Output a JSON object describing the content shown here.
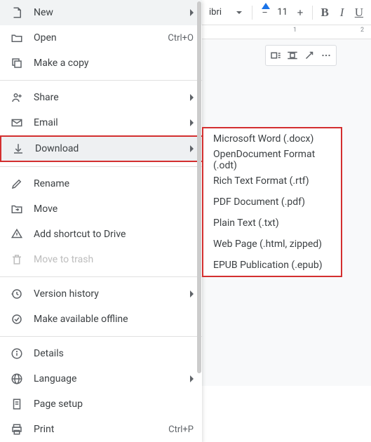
{
  "menu": {
    "items": [
      {
        "label": "New",
        "has_submenu": true
      },
      {
        "label": "Open",
        "shortcut": "Ctrl+O"
      },
      {
        "label": "Make a copy"
      },
      {
        "label": "Share",
        "has_submenu": true
      },
      {
        "label": "Email",
        "has_submenu": true
      },
      {
        "label": "Download",
        "has_submenu": true
      },
      {
        "label": "Rename"
      },
      {
        "label": "Move"
      },
      {
        "label": "Add shortcut to Drive"
      },
      {
        "label": "Move to trash"
      },
      {
        "label": "Version history",
        "has_submenu": true
      },
      {
        "label": "Make available offline"
      },
      {
        "label": "Details"
      },
      {
        "label": "Language",
        "has_submenu": true
      },
      {
        "label": "Page setup"
      },
      {
        "label": "Print",
        "shortcut": "Ctrl+P"
      }
    ]
  },
  "download_submenu": {
    "items": [
      "Microsoft Word (.docx)",
      "OpenDocument Format (.odt)",
      "Rich Text Format (.rtf)",
      "PDF Document (.pdf)",
      "Plain Text (.txt)",
      "Web Page (.html, zipped)",
      "EPUB Publication (.epub)"
    ]
  },
  "toolbar": {
    "font_name": "ibri",
    "font_size": "11"
  },
  "ruler": {
    "marks": [
      "1",
      "2"
    ]
  }
}
